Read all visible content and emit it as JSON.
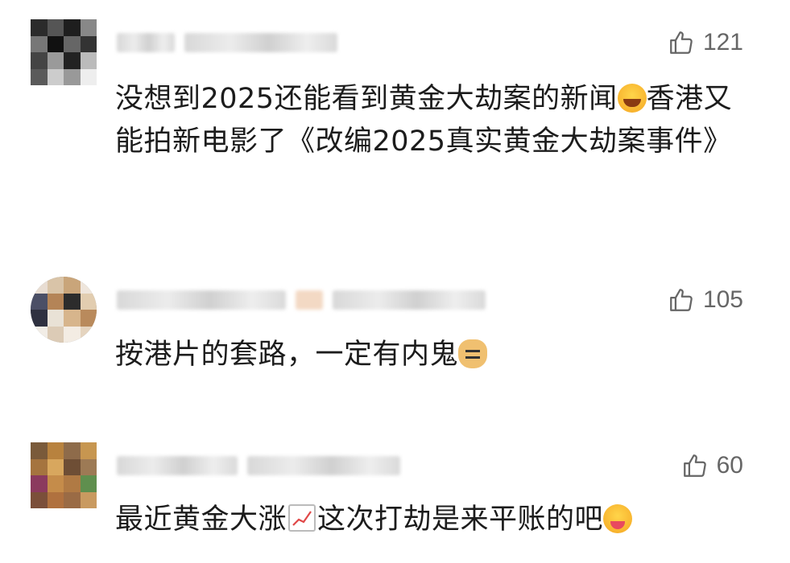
{
  "comments": [
    {
      "likes": "121",
      "text_parts": [
        "没想到2025还能看到黄金大劫案的新闻",
        "香港又能拍新电影了《改编2025真实黄金大劫案事件》"
      ],
      "emoji": "laugh-cry-emoji"
    },
    {
      "likes": "105",
      "text_parts": [
        "按港片的套路，一定有内鬼"
      ],
      "emoji": "doge-emoji"
    },
    {
      "likes": "60",
      "text_parts": [
        "最近黄金大涨",
        "这次打劫是来平账的吧"
      ],
      "emoji": [
        "chart-increasing-emoji",
        "drooling-emoji"
      ]
    }
  ],
  "icons": {
    "like": "thumbs-up-icon"
  },
  "colors": {
    "text": "#1c1c1c",
    "meta": "#666666",
    "background": "#ffffff"
  }
}
